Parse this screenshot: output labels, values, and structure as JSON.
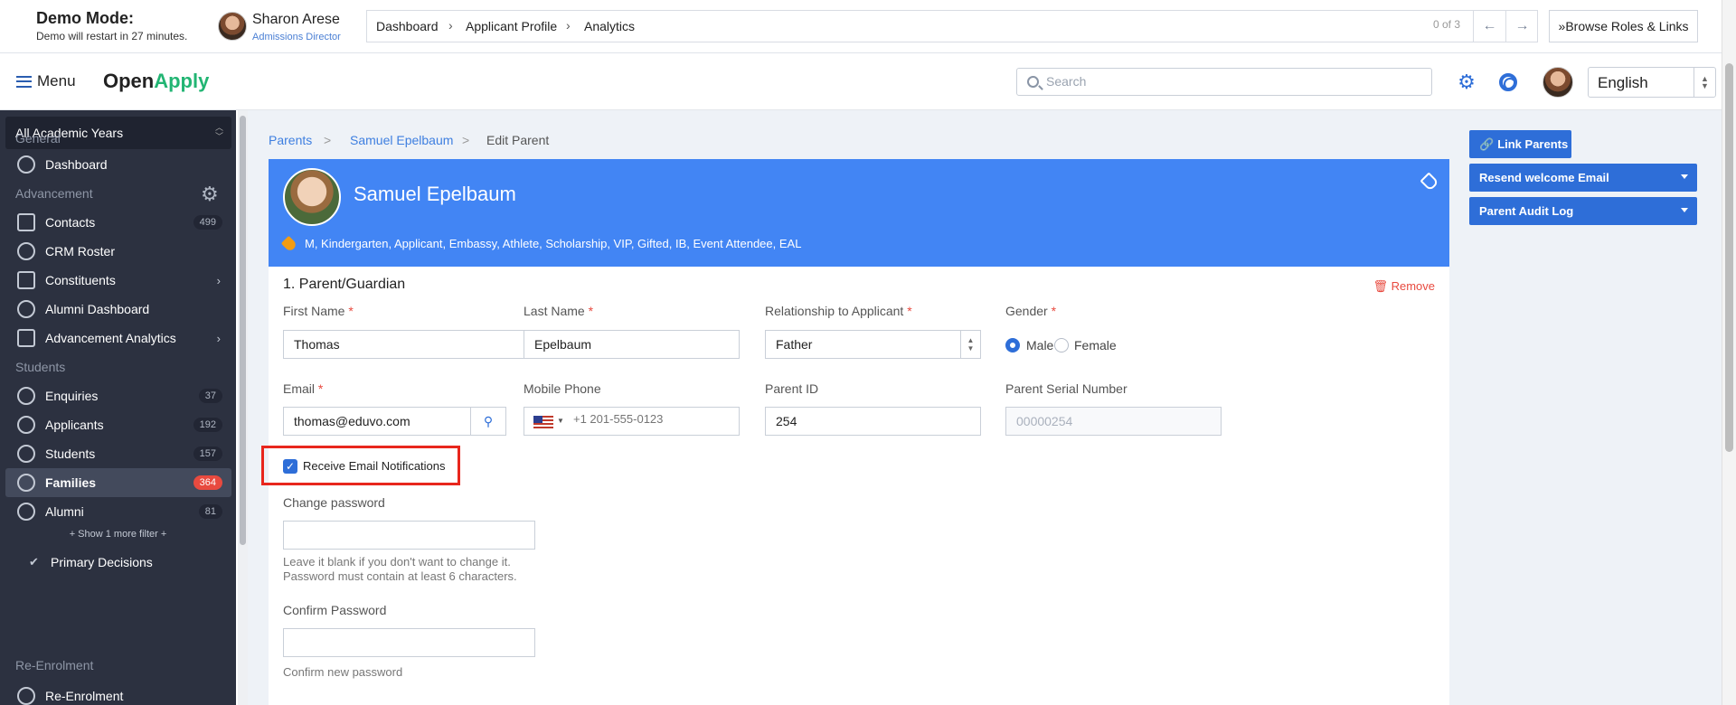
{
  "demo": {
    "title": "Demo Mode:",
    "subtitle": "Demo will restart in 27 minutes.",
    "user_name": "Sharon Arese",
    "user_role": "Admissions Director"
  },
  "breadcrumb_top": {
    "items": [
      "Dashboard",
      "Applicant Profile",
      "Analytics"
    ],
    "count": "0 of 3",
    "browse_label": "Browse Roles & Links"
  },
  "header": {
    "menu_label": "Menu",
    "logo_a": "Open",
    "logo_b": "Apply",
    "search_placeholder": "Search",
    "language": "English"
  },
  "sidebar": {
    "year": "All Academic Years",
    "sections": {
      "general": "General",
      "advancement": "Advancement",
      "students": "Students",
      "reenrolment": "Re-Enrolment"
    },
    "items": [
      {
        "label": "Dashboard"
      },
      {
        "label": "Contacts",
        "count": "499"
      },
      {
        "label": "CRM Roster"
      },
      {
        "label": "Constituents"
      },
      {
        "label": "Alumni Dashboard"
      },
      {
        "label": "Advancement Analytics"
      },
      {
        "label": "Enquiries",
        "count": "37"
      },
      {
        "label": "Applicants",
        "count": "192"
      },
      {
        "label": "Students",
        "count": "157"
      },
      {
        "label": "Families",
        "count": "364"
      },
      {
        "label": "Alumni",
        "count": "81"
      },
      {
        "label": "Re-Enrolment"
      }
    ],
    "more_filter": "+ Show 1 more filter +",
    "primary_decisions": "Primary Decisions"
  },
  "main": {
    "breadcrumb": [
      "Parents",
      "Samuel Epelbaum",
      "Edit Parent"
    ],
    "banner_name": "Samuel Epelbaum",
    "tags": "M,  Kindergarten,  Applicant,   Embassy,   Athlete,   Scholarship,   VIP,   Gifted,   IB,   Event Attendee,   EAL",
    "section_title": "1. Parent/Guardian",
    "remove_label": "Remove",
    "fields": {
      "first_name_label": "First Name",
      "first_name": "Thomas",
      "last_name_label": "Last Name",
      "last_name": "Epelbaum",
      "relationship_label": "Relationship to Applicant",
      "relationship": "Father",
      "gender_label": "Gender",
      "gender_male": "Male",
      "gender_female": "Female",
      "email_label": "Email",
      "email": "thomas@eduvo.com",
      "mobile_label": "Mobile Phone",
      "mobile_placeholder": "+1 201-555-0123",
      "parent_id_label": "Parent ID",
      "parent_id": "254",
      "serial_label": "Parent Serial Number",
      "serial_placeholder": "00000254",
      "notifications_label": "Receive Email Notifications",
      "change_password_label": "Change password",
      "password_help_1": "Leave it blank if you don't want to change it.",
      "password_help_2": "Password must contain at least 6 characters.",
      "confirm_password_label": "Confirm Password",
      "confirm_help": "Confirm new password"
    }
  },
  "actions": {
    "link_parents": "Link Parents",
    "resend_email": "Resend welcome Email",
    "audit_log": "Parent Audit Log"
  },
  "colors": {
    "primary": "#2e6ed8",
    "banner": "#4285f4",
    "sidebar": "#2c3140",
    "danger": "#e84a3f",
    "logo_green": "#22b573"
  }
}
